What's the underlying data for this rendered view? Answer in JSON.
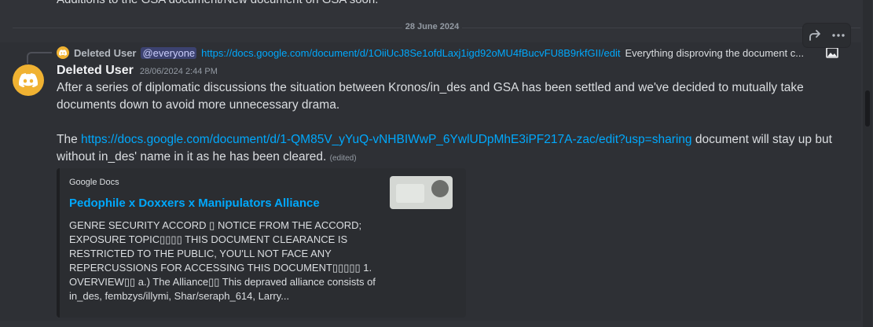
{
  "previous_message": {
    "text": "Additions to the GSA document/New document on GSA soon."
  },
  "date_divider": "28 June 2024",
  "reply": {
    "author": "Deleted User",
    "mention": "@everyone",
    "link": "https://docs.google.com/document/d/1OiiUcJ8Se1ofdLaxj1igd92oMU4fBucvFU8B9rkfGII/edit",
    "text": "Everything disproving the document c..."
  },
  "message": {
    "author": "Deleted User",
    "timestamp": "28/06/2024 2:44 PM",
    "paragraph1": "After a series of diplomatic discussions the situation between Kronos/in_des and GSA has been settled and we've decided to mutually take documents down to avoid more unnecessary drama.",
    "paragraph2_prefix": "The ",
    "paragraph2_link": "https://docs.google.com/document/d/1-QM85V_yYuQ-vNHBIWwP_6YwlUDpMhE3iPF217A-zac/edit?usp=sharing",
    "paragraph2_suffix": " document will stay up but without in_des' name in it as he has been cleared.",
    "edited_label": "(edited)"
  },
  "embed": {
    "provider": "Google Docs",
    "title": "Pedophile x Doxxers x Manipulators Alliance",
    "description": "GENRE SECURITY ACCORD ▯ NOTICE FROM THE ACCORD; EXPOSURE TOPIC▯▯▯▯ THIS DOCUMENT CLEARANCE IS RESTRICTED TO THE PUBLIC, YOU'LL NOT FACE ANY REPERCUSSIONS FOR ACCESSING THIS DOCUMENT▯▯▯▯▯ 1. OVERVIEW▯▯ a.) The Alliance▯▯ This depraved alliance consists of in_des, fembzys/illymi, Shar/seraph_614, Larry..."
  },
  "icons": {
    "avatar": "discord-logo-icon",
    "forward": "forward-icon",
    "more": "more-options-icon",
    "image": "image-icon"
  },
  "colors": {
    "background": "#313338",
    "hover_background": "#2e3035",
    "link": "#00a8fc",
    "avatar": "#f0b232",
    "mention_bg": "#3c4270"
  }
}
